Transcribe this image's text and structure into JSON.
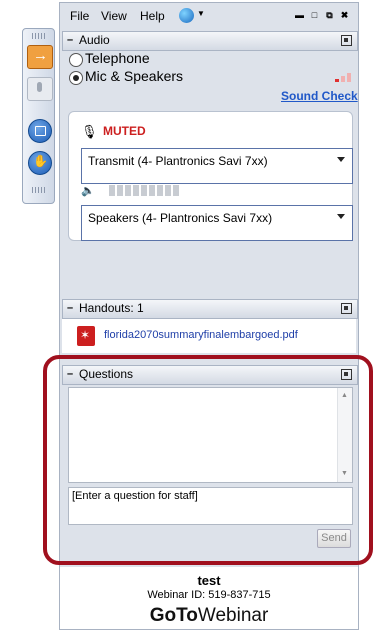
{
  "menu": {
    "file": "File",
    "view": "View",
    "help": "Help"
  },
  "audio": {
    "header": "Audio",
    "telephone": "Telephone",
    "mic_speakers": "Mic & Speakers",
    "sound_check": "Sound Check",
    "muted": "MUTED",
    "transmit_select": "Transmit (4- Plantronics Savi 7xx)",
    "speakers_select": "Speakers (4- Plantronics Savi 7xx)",
    "selected_mode": "Mic & Speakers"
  },
  "handouts": {
    "header": "Handouts: 1",
    "file": "florida2070summaryfinalembargoed.pdf"
  },
  "questions": {
    "header": "Questions",
    "placeholder": "[Enter a question for staff]",
    "send": "Send"
  },
  "footer": {
    "name": "test",
    "webinar_id": "Webinar ID: 519-837-715",
    "brand_goto": "GoTo",
    "brand_webinar": "Webinar"
  },
  "colors": {
    "accent_link": "#2058c8",
    "muted_red": "#cc1f1f",
    "highlight_border": "#a0101e"
  },
  "icons": [
    "grip-icon",
    "arrow-icon",
    "mic-icon",
    "screen-icon",
    "hand-icon",
    "globe-icon",
    "minimize-icon",
    "maximize-icon",
    "popout-icon",
    "close-icon",
    "speaker-icon",
    "pdf-icon"
  ]
}
